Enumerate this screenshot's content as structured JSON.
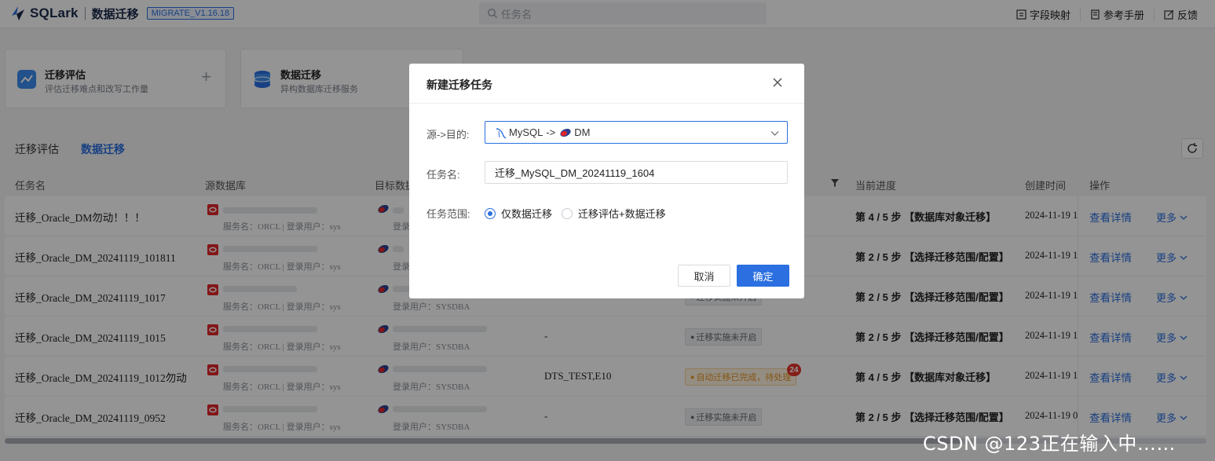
{
  "header": {
    "brand": "SQLark",
    "product": "数据迁移",
    "version": "MIGRATE_V1.16.18",
    "search_placeholder": "任务名",
    "links": [
      "字段映射",
      "参考手册",
      "反馈"
    ]
  },
  "cards": [
    {
      "title": "迁移评估",
      "desc": "评估迁移难点和改写工作量",
      "plus": "+"
    },
    {
      "title": "数据迁移",
      "desc": "异构数据库迁移服务"
    }
  ],
  "tabs": [
    "迁移评估",
    "数据迁移"
  ],
  "table": {
    "columns": [
      "任务名",
      "源数据库",
      "目标数据库",
      "当前进度",
      "创建时间",
      "操作"
    ],
    "rows": [
      {
        "task": "迁移_Oracle_DM勿动！！！",
        "svc": "服务名：ORCL | 登录用户：sys",
        "login": "登录用户：SYSDBA",
        "schema": "",
        "status": "",
        "progress": "第 4 / 5 步 【数据库对象迁移】",
        "time": "2024-11-19 1",
        "detail": "查看详情",
        "more": "更多"
      },
      {
        "task": "迁移_Oracle_DM_20241119_101811",
        "svc": "服务名：ORCL | 登录用户：sys",
        "login": "登录用户：SYSDBA",
        "schema": "",
        "status": "",
        "progress": "第 2 / 5 步 【选择迁移范围/配置】",
        "time": "2024-11-19 1",
        "detail": "查看详情",
        "more": "更多"
      },
      {
        "task": "迁移_Oracle_DM_20241119_1017",
        "svc": "服务名：ORCL | 登录用户：sys",
        "login": "登录用户：SYSDBA",
        "schema": "",
        "status": "迁移实施未开启",
        "progress": "第 2 / 5 步 【选择迁移范围/配置】",
        "time": "2024-11-19 1",
        "detail": "查看详情",
        "more": "更多"
      },
      {
        "task": "迁移_Oracle_DM_20241119_1015",
        "svc": "服务名：ORCL | 登录用户：sys",
        "login": "登录用户：SYSDBA",
        "schema": "-",
        "status": "迁移实施未开启",
        "progress": "第 2 / 5 步 【选择迁移范围/配置】",
        "time": "2024-11-19 1",
        "detail": "查看详情",
        "more": "更多"
      },
      {
        "task": "迁移_Oracle_DM_20241119_1012勿动",
        "svc": "服务名：ORCL | 登录用户：sys",
        "login": "登录用户：SYSDBA",
        "schema": "DTS_TEST,E10",
        "status": "自动迁移已完成，待处理",
        "badge": "24",
        "progress": "第 4 / 5 步 【数据库对象迁移】",
        "time": "2024-11-19 1",
        "detail": "查看详情",
        "more": "更多"
      },
      {
        "task": "迁移_Oracle_DM_20241119_0952",
        "svc": "服务名：ORCL | 登录用户：sys",
        "login": "登录用户：SYSDBA",
        "schema": "-",
        "status": "迁移实施未开启",
        "progress": "第 2 / 5 步 【选择迁移范围/配置】",
        "time": "2024-11-19 0",
        "detail": "查看详情",
        "more": "更多"
      }
    ]
  },
  "dialog": {
    "title": "新建迁移任务",
    "source_label": "源->目的:",
    "source_from": "MySQL",
    "source_arrow": "->",
    "source_to": "DM",
    "name_label": "任务名:",
    "name_value": "迁移_MySQL_DM_20241119_1604",
    "scope_label": "任务范围:",
    "scope_options": [
      "仅数据迁移",
      "迁移评估+数据迁移"
    ],
    "cancel": "取消",
    "ok": "确定"
  },
  "watermark": "CSDN @123正在输入中……",
  "colors": {
    "accent": "#2b6fe0",
    "badge": "#e5342c",
    "status_orange": "#e69524"
  }
}
